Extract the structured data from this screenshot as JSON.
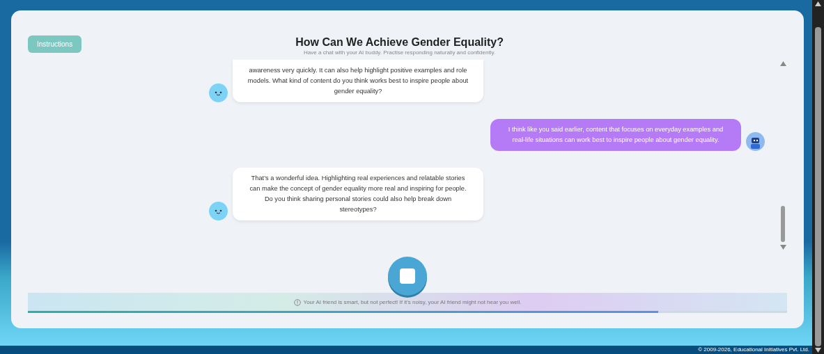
{
  "instructions_button": "Instructions",
  "title": "How Can We Achieve Gender Equality?",
  "subtitle": "Have a chat with your AI buddy. Practise responding naturally and confidently.",
  "messages": [
    {
      "kind": "bot",
      "text": "awareness very quickly. It can also help highlight positive examples and role models. What kind of content do you think works best to inspire people about gender equality?"
    },
    {
      "kind": "user",
      "text": "I think like you said earlier, content that focuses on everyday examples and real-life situations can work best to inspire people about gender equality."
    },
    {
      "kind": "bot",
      "text": "That’s a wonderful idea. Highlighting real experiences and relatable stories can make the concept of gender equality more real and inspiring for people. Do you think sharing personal stories could also help break down stereotypes?"
    }
  ],
  "notice": "Your AI friend is smart, but not perfect! If it’s noisy, your AI friend might not hear you well.",
  "progress": {
    "level": 0.83
  },
  "footer": "© 2009-2026, Educational Initiatives Pvt. Ltd."
}
